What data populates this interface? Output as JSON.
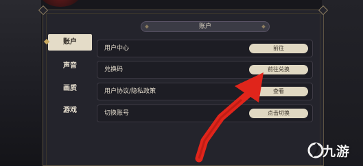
{
  "header": {
    "title": "账户"
  },
  "tabs": [
    {
      "label": "账户",
      "active": true
    },
    {
      "label": "声音",
      "active": false
    },
    {
      "label": "画质",
      "active": false
    },
    {
      "label": "游戏",
      "active": false
    }
  ],
  "rows": [
    {
      "label": "用户中心",
      "button": "前往"
    },
    {
      "label": "兑换码",
      "button": "前往兑换"
    },
    {
      "label": "用户协议/隐私政策",
      "button": "查看"
    },
    {
      "label": "切换账号",
      "button": "点击切换"
    }
  ],
  "watermark": {
    "text": "九游",
    "logo_icon": "nine-game-logo-icon"
  },
  "colors": {
    "accent": "#e0d8c2",
    "arrow": "#e0251b",
    "panel": "#24242c"
  }
}
